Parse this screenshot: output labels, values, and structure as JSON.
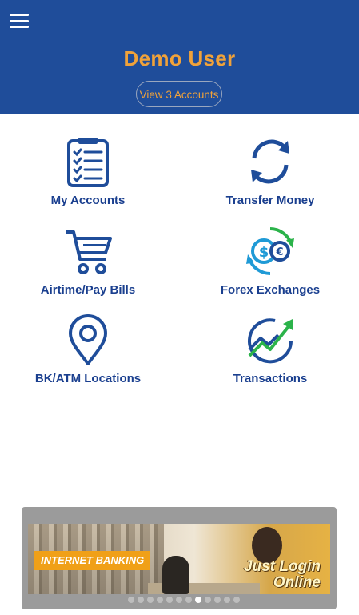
{
  "header": {
    "menu_icon": "hamburger-menu-icon",
    "user_name": "Demo User",
    "view_accounts_label": "View 3 Accounts"
  },
  "tiles": [
    {
      "label": "My Accounts",
      "icon": "checklist-icon"
    },
    {
      "label": "Transfer Money",
      "icon": "refresh-arrows-icon"
    },
    {
      "label": "Airtime/Pay Bills",
      "icon": "shopping-cart-icon"
    },
    {
      "label": "Forex Exchanges",
      "icon": "currency-exchange-icon"
    },
    {
      "label": "BK/ATM Locations",
      "icon": "map-pin-icon"
    },
    {
      "label": "Transactions",
      "icon": "trend-chart-icon"
    }
  ],
  "banner": {
    "tag": "INTERNET BANKING",
    "headline_line1": "Just Login",
    "headline_line2": "Online",
    "slide_count": 12,
    "active_slide": 8
  },
  "colors": {
    "header_bg": "#1f4d9a",
    "accent": "#f0a23a",
    "tile_text": "#1a3f8f",
    "icon_blue": "#1f4d9a",
    "icon_green": "#2bb34a"
  }
}
